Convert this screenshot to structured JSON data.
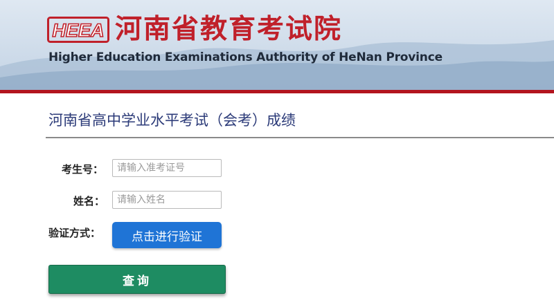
{
  "header": {
    "logo_text": "HEEA",
    "title_cn": "河南省教育考试院",
    "title_en": "Higher Education Examinations Authority of HeNan Province"
  },
  "page": {
    "title": "河南省高中学业水平考试（会考）成绩"
  },
  "form": {
    "exam_number": {
      "label": "考生号：",
      "value": "",
      "placeholder": "请输入准考证号"
    },
    "name": {
      "label": "姓名：",
      "value": "",
      "placeholder": "请输入姓名"
    },
    "verification": {
      "label": "验证方式：",
      "button_label": "点击进行验证"
    },
    "submit_label": "查询"
  },
  "colors": {
    "brand_red": "#c0202a",
    "divider_red": "#b3141e",
    "title_blue": "#2b3a78",
    "verify_blue": "#1f74d6",
    "query_green": "#1e8c62"
  }
}
